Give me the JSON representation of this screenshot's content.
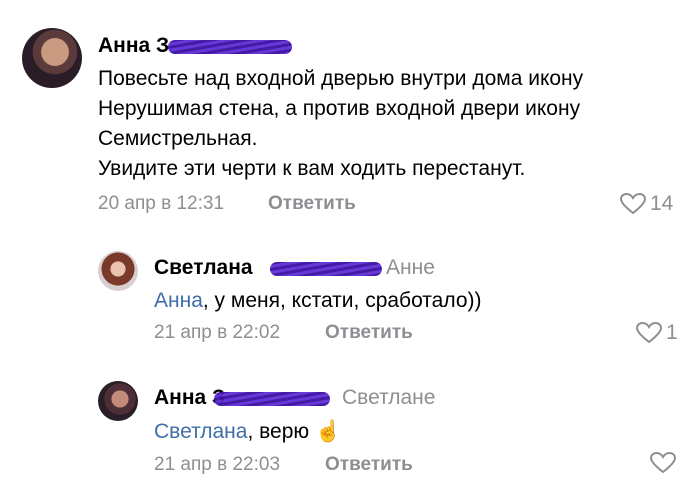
{
  "comments": [
    {
      "author": "Анна З",
      "lines": [
        "Повесьте над входной дверью внутри дома икону",
        "Нерушимая стена, а против входной двери икону",
        "Семистрельная.",
        "Увидите эти черти к вам ходить перестанут."
      ],
      "time": "20 апр в 12:31",
      "reply_label": "Ответить",
      "likes": "14",
      "like_icon": "heart-outline-icon"
    },
    {
      "author": "Светлана",
      "reply_to": "Анне",
      "mention": "Анна",
      "text": ", у меня, кстати, сработало))",
      "time": "21 апр в 22:02",
      "reply_label": "Ответить",
      "likes": "1",
      "like_icon": "heart-outline-icon"
    },
    {
      "author": "Анна З",
      "reply_to": "Светлане",
      "mention": "Светлана",
      "text": ", верю ",
      "emoji": "☝️",
      "time": "21 апр в 22:03",
      "reply_label": "Ответить",
      "likes": "",
      "like_icon": "heart-outline-icon"
    }
  ],
  "colors": {
    "muted": "#8e8e93",
    "mention": "#3f6ea8",
    "scribble": "#4b1fc0"
  }
}
